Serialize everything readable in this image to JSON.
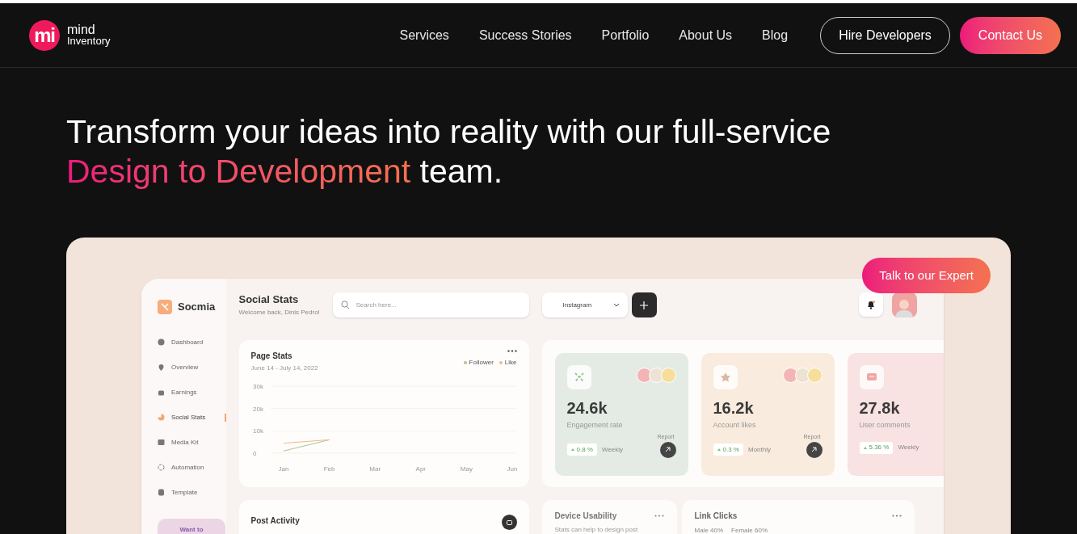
{
  "logo": {
    "mark": "mi",
    "name_line_1": "mind",
    "name_line_2": "Inventory"
  },
  "nav": [
    "Services",
    "Success Stories",
    "Portfolio",
    "About Us",
    "Blog"
  ],
  "header_buttons": [
    {
      "label": "Hire Developers",
      "kind": "outline"
    },
    {
      "label": "Contact Us",
      "kind": "gradient"
    }
  ],
  "hero": {
    "line_1": "Transform your ideas into reality with our full-service",
    "highlight": "Design to Development",
    "rest": " team."
  },
  "talk_button": "Talk to our Expert",
  "dashboard": {
    "brand": "Socmia",
    "sidebar_items": [
      {
        "label": "Dashboard",
        "selected": false
      },
      {
        "label": "Overview",
        "selected": false
      },
      {
        "label": "Earnings",
        "selected": false
      },
      {
        "label": "Social Stats",
        "selected": true
      },
      {
        "label": "Media Kit",
        "selected": false
      },
      {
        "label": "Automation",
        "selected": false
      },
      {
        "label": "Template",
        "selected": false
      }
    ],
    "sidebar_button": "Want to",
    "title": "Social Stats",
    "subtitle": "Welcome back, Dinis Pedro!",
    "search": {
      "placeholder": "Search here..."
    },
    "platform_select": "Instagram",
    "page_stats": {
      "title": "Page Stats",
      "date_range": "June 14 - July 14, 2022",
      "chart_data": {
        "type": "line",
        "categories": [
          "Jan",
          "Feb",
          "Mar",
          "Apr",
          "May",
          "Jun"
        ],
        "ylim": [
          0,
          30000
        ],
        "yticks": [
          {
            "value": 0,
            "label": "0"
          },
          {
            "value": 10000,
            "label": "10k"
          },
          {
            "value": 20000,
            "label": "20k"
          },
          {
            "value": 30000,
            "label": "30k"
          }
        ],
        "series": [
          {
            "name": "Follower",
            "color": "#a8c88e",
            "values": [
              1000,
              6000,
              null,
              null,
              null,
              null
            ]
          },
          {
            "name": "Like",
            "color": "#f2b88c",
            "values": [
              4500,
              6000,
              null,
              null,
              null,
              null
            ]
          }
        ]
      }
    },
    "stat_cards": [
      {
        "value": "24.6k",
        "label": "Engagement rate",
        "change": "0.8 %",
        "period": "Weekly",
        "report": "Report",
        "avatars": true,
        "color": "#e4ebe5"
      },
      {
        "value": "16.2k",
        "label": "Account likes",
        "change": "0.3 %",
        "period": "Monthly",
        "report": "Report",
        "avatars": true,
        "color": "#f9ebdd"
      },
      {
        "value": "27.8k",
        "label": "User comments",
        "change": "5.36 %",
        "period": "Weekly",
        "avatars": false,
        "color": "#f8e2e2"
      }
    ],
    "post_activity": {
      "title": "Post Activity"
    },
    "device_usability": {
      "title": "Device Usability",
      "subtitle": "Stats can help to design post"
    },
    "link_clicks": {
      "title": "Link Clicks",
      "legend": [
        "Male 40%",
        "Female 60%"
      ]
    }
  }
}
